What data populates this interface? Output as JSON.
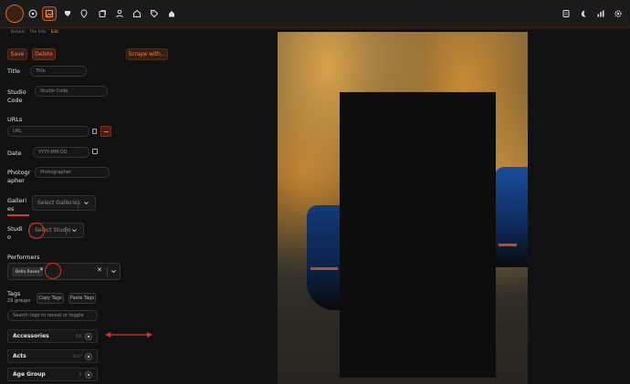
{
  "nav": {
    "left_icons": [
      "scenes-icon",
      "images-icon",
      "tags-icon",
      "map-pin-icon",
      "galleries-icon",
      "performers-icon",
      "studios-icon",
      "tag-icon",
      "groups-icon"
    ],
    "right_icons": [
      "queue-icon",
      "moon-icon",
      "stats-icon",
      "gear-icon"
    ]
  },
  "breadcrumb": {
    "items": [
      "Details",
      "File Info",
      "Edit"
    ]
  },
  "actions": {
    "save_label": "Save",
    "delete_label": "Delete",
    "scrape_label": "Scrape with..."
  },
  "form": {
    "title": {
      "label": "Title",
      "placeholder": "Title"
    },
    "studio_code": {
      "label_line1": "Studio",
      "label_line2": "Code",
      "placeholder": "Studio Code"
    },
    "urls": {
      "label": "URLs",
      "placeholder": "URL"
    },
    "date": {
      "label": "Date",
      "placeholder": "YYYY-MM-DD"
    },
    "photographer": {
      "label_line1": "Photogr",
      "label_line2": "apher",
      "placeholder": "Photographer"
    },
    "galleries": {
      "label_line1": "Galleri",
      "label_line2": "es",
      "placeholder": "Select Galleries"
    },
    "studio": {
      "label_line1": "Studi",
      "label_line2": "o",
      "placeholder": "Select Studio"
    },
    "performers": {
      "label": "Performers",
      "chips": [
        "Bella Rasee"
      ]
    },
    "tags": {
      "label": "Tags",
      "groups_count": "29 groups",
      "copy_label": "Copy Tags",
      "paste_label": "Paste Tags",
      "search_placeholder": "Search tags to reveal or toggle",
      "groups": [
        {
          "name": "Accessories",
          "count": "0/8"
        },
        {
          "name": "Acts",
          "count": "0/17"
        },
        {
          "name": "Age Group",
          "count": "0"
        }
      ]
    }
  },
  "colors": {
    "accent": "#e0874f",
    "danger": "#e07a5e",
    "annotation": "#e0301e"
  }
}
